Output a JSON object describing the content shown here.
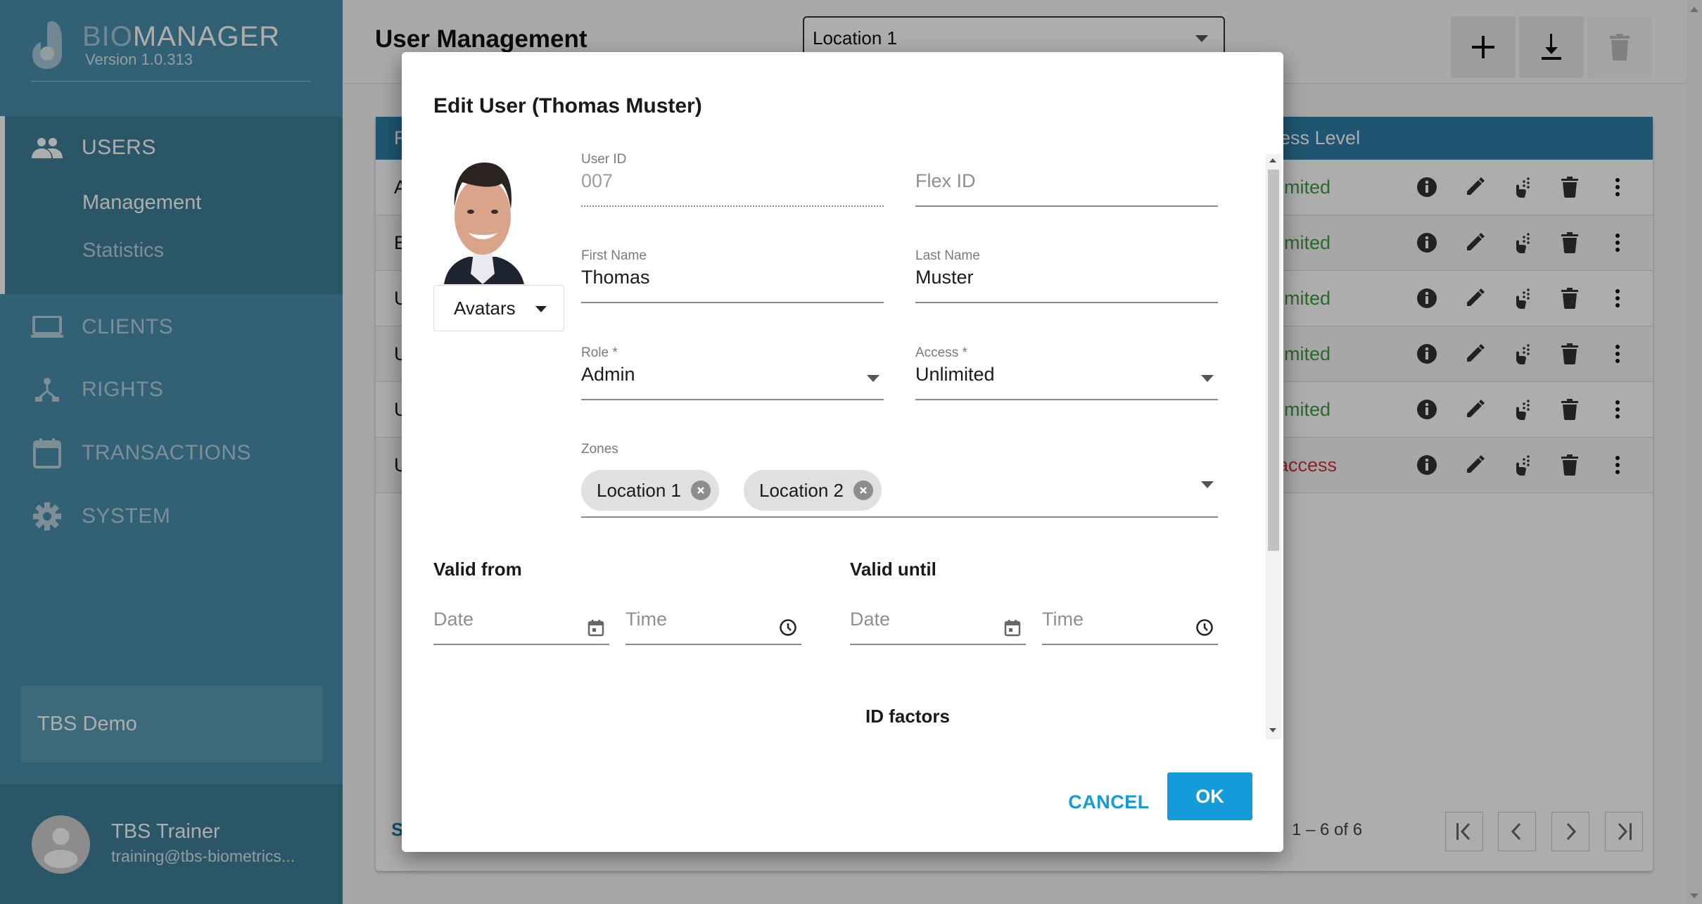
{
  "app": {
    "name_part1": "BIO",
    "name_part2": "MANAGER",
    "version": "Version 1.0.313"
  },
  "sidebar": {
    "items": [
      {
        "label": "USERS",
        "icon": "people-icon",
        "active": true,
        "sub_items": [
          {
            "label": "Management",
            "active": true
          },
          {
            "label": "Statistics",
            "active": false
          }
        ]
      },
      {
        "label": "CLIENTS",
        "icon": "laptop-icon",
        "active": false
      },
      {
        "label": "RIGHTS",
        "icon": "hierarchy-icon",
        "active": false
      },
      {
        "label": "TRANSACTIONS",
        "icon": "calendar-icon",
        "active": false
      },
      {
        "label": "SYSTEM",
        "icon": "gear-icon",
        "active": false
      }
    ],
    "organization": "TBS Demo",
    "user": {
      "name": "TBS Trainer",
      "email": "training@tbs-biometrics..."
    }
  },
  "header": {
    "title": "User Management",
    "location_select": "Location 1",
    "toolbar": [
      {
        "icon": "add-icon",
        "enabled": true
      },
      {
        "icon": "download-icon",
        "enabled": true
      },
      {
        "icon": "delete-icon",
        "enabled": false
      }
    ]
  },
  "table": {
    "visible_header_fragments": {
      "first": "F",
      "last": "ess Level"
    },
    "rows": [
      {
        "first_char": "A",
        "access": "imited",
        "access_status": "ok"
      },
      {
        "first_char": "B",
        "access": "imited",
        "access_status": "ok"
      },
      {
        "first_char": "U",
        "access": "imited",
        "access_status": "ok"
      },
      {
        "first_char": "U",
        "access": "imited",
        "access_status": "ok"
      },
      {
        "first_char": "U",
        "access": "imited",
        "access_status": "ok"
      },
      {
        "first_char": "U",
        "access": "access",
        "access_status": "none"
      }
    ],
    "row_actions": [
      "info-icon",
      "edit-icon",
      "fingerprint-touch-icon",
      "delete-icon",
      "more-vert-icon"
    ],
    "footer_link_fragment": "S",
    "pagination": {
      "range": "1 – 6 of 6",
      "buttons": [
        "first-page",
        "previous-page",
        "next-page",
        "last-page"
      ]
    }
  },
  "dialog": {
    "title": "Edit User (Thomas Muster)",
    "avatar_button": "Avatars",
    "fields": {
      "user_id": {
        "label": "User ID",
        "value": "007",
        "readonly": true
      },
      "flex_id": {
        "label": "",
        "placeholder": "Flex ID",
        "value": ""
      },
      "first_name": {
        "label": "First Name",
        "value": "Thomas"
      },
      "last_name": {
        "label": "Last Name",
        "value": "Muster"
      },
      "role": {
        "label": "Role *",
        "value": "Admin"
      },
      "access": {
        "label": "Access *",
        "value": "Unlimited"
      },
      "zones": {
        "label": "Zones",
        "chips": [
          "Location 1",
          "Location 2"
        ]
      }
    },
    "valid_from": {
      "heading": "Valid from",
      "date_placeholder": "Date",
      "time_placeholder": "Time"
    },
    "valid_until": {
      "heading": "Valid until",
      "date_placeholder": "Date",
      "time_placeholder": "Time"
    },
    "id_factors_heading": "ID factors",
    "cancel_label": "CANCEL",
    "ok_label": "OK"
  },
  "colors": {
    "sidebar": "#4a90ad",
    "table_header": "#2e7ea6",
    "primary": "#149bd9",
    "access_ok": "#3d9b3d",
    "access_denied": "#c8363d"
  }
}
